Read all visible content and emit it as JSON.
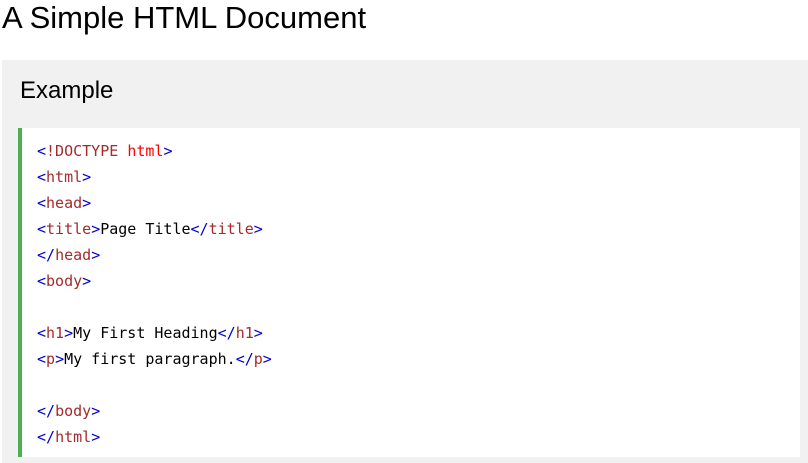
{
  "page": {
    "title": "A Simple HTML Document"
  },
  "example": {
    "heading": "Example",
    "code": {
      "doctype": {
        "open": "<",
        "keyword": "!DOCTYPE",
        "space": " ",
        "attr": "html",
        "close": ">"
      },
      "html_open": {
        "lt": "<",
        "name": "html",
        "gt": ">"
      },
      "head_open": {
        "lt": "<",
        "name": "head",
        "gt": ">"
      },
      "title_line": {
        "lt1": "<",
        "name1": "title",
        "gt1": ">",
        "text": "Page Title",
        "lt2": "</",
        "name2": "title",
        "gt2": ">"
      },
      "head_close": {
        "lt": "</",
        "name": "head",
        "gt": ">"
      },
      "body_open": {
        "lt": "<",
        "name": "body",
        "gt": ">"
      },
      "h1_line": {
        "lt1": "<",
        "name1": "h1",
        "gt1": ">",
        "text": "My First Heading",
        "lt2": "</",
        "name2": "h1",
        "gt2": ">"
      },
      "p_line": {
        "lt1": "<",
        "name1": "p",
        "gt1": ">",
        "text": "My first paragraph.",
        "lt2": "</",
        "name2": "p",
        "gt2": ">"
      },
      "body_close": {
        "lt": "</",
        "name": "body",
        "gt": ">"
      },
      "html_close": {
        "lt": "</",
        "name": "html",
        "gt": ">"
      }
    },
    "colors": {
      "accent_border": "#4caf50",
      "panel_background": "#f1f1f1",
      "tag_bracket": "#0000cd",
      "tag_name": "#a52a2a",
      "doctype_attr": "#ff0000"
    }
  }
}
